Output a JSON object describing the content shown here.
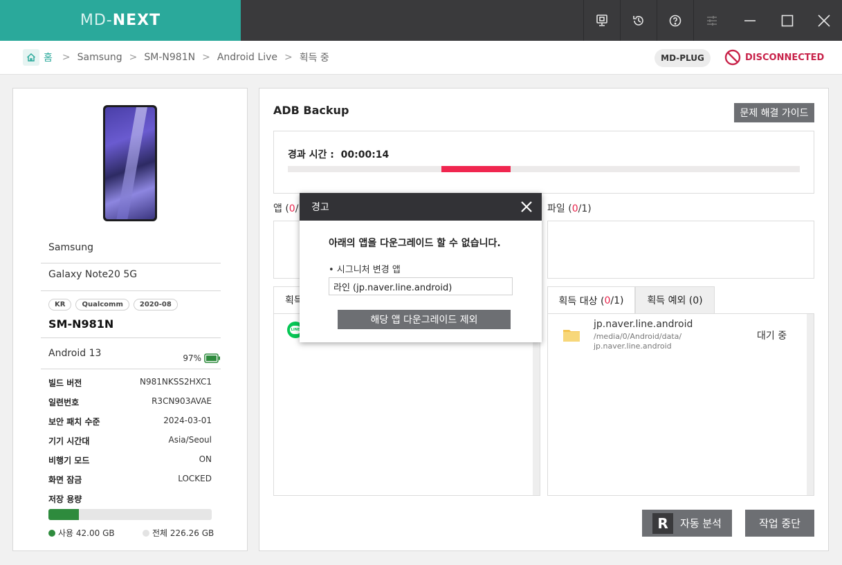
{
  "app": {
    "logo_light": "MD-",
    "logo_bold": "NEXT"
  },
  "titlebar": {
    "icons": [
      "monitor-icon",
      "history-icon",
      "help-icon",
      "settings-sliders-icon",
      "minimize-icon",
      "maximize-icon",
      "close-icon"
    ]
  },
  "breadcrumb": {
    "home": "홈",
    "items": [
      "Samsung",
      "SM-N981N",
      "Android Live",
      "획득 중"
    ]
  },
  "status": {
    "plug": "MD-PLUG",
    "connection": "DISCONNECTED"
  },
  "device": {
    "manufacturer": "Samsung",
    "model_name": "Galaxy Note20 5G",
    "tags": [
      "KR",
      "Qualcomm",
      "2020-08"
    ],
    "model": "SM-N981N",
    "os": "Android 13",
    "battery": "97%",
    "info": [
      {
        "key": "빌드 버전",
        "value": "N981NKSS2HXC1"
      },
      {
        "key": "일련번호",
        "value": "R3CN903AVAE"
      },
      {
        "key": "보안 패치 수준",
        "value": "2024-03-01"
      },
      {
        "key": "기기 시간대",
        "value": "Asia/Seoul"
      },
      {
        "key": "비행기 모드",
        "value": "ON"
      },
      {
        "key": "화면 잠금",
        "value": "LOCKED"
      }
    ],
    "storage_label": "저장 용량",
    "storage_used_fraction": 0.186,
    "used_label": "사용 42.00 GB",
    "total_label": "전체 226.26 GB",
    "colors": {
      "used": "#2e8b3d",
      "total": "#e6e6e6"
    }
  },
  "main": {
    "title": "ADB Backup",
    "guide_button": "문제 해결 가이드",
    "elapsed_label": "경과 시간 :",
    "elapsed_value": "00:00:14",
    "app_section": {
      "label": "앱 (",
      "count": "0",
      "suffix": "/"
    },
    "file_section": {
      "label": "파일 (",
      "count": "0",
      "suffix": "/1)"
    },
    "left_tab_partial": "획득",
    "right_tabs": [
      {
        "label": "획득 대상 (",
        "count": "0",
        "suffix": "/1)"
      },
      {
        "label": "획득 예외 (0)"
      }
    ],
    "file_item": {
      "name": "jp.naver.line.android",
      "path_line1": "/media/0/Android/data/",
      "path_line2": "jp.naver.line.android",
      "status": "대기 중"
    },
    "auto_analysis_button": "자동 분석",
    "auto_analysis_letter": "R",
    "stop_button": "작업 중단",
    "accent_color": "#f0264f"
  },
  "modal": {
    "title": "경고",
    "message": "아래의 앱을 다운그레이드 할 수 없습니다.",
    "bullet": "• 시그니처 변경 앱",
    "app_value": "라인 (jp.naver.line.android)",
    "button": "해당 앱 다운그레이드 제외"
  }
}
